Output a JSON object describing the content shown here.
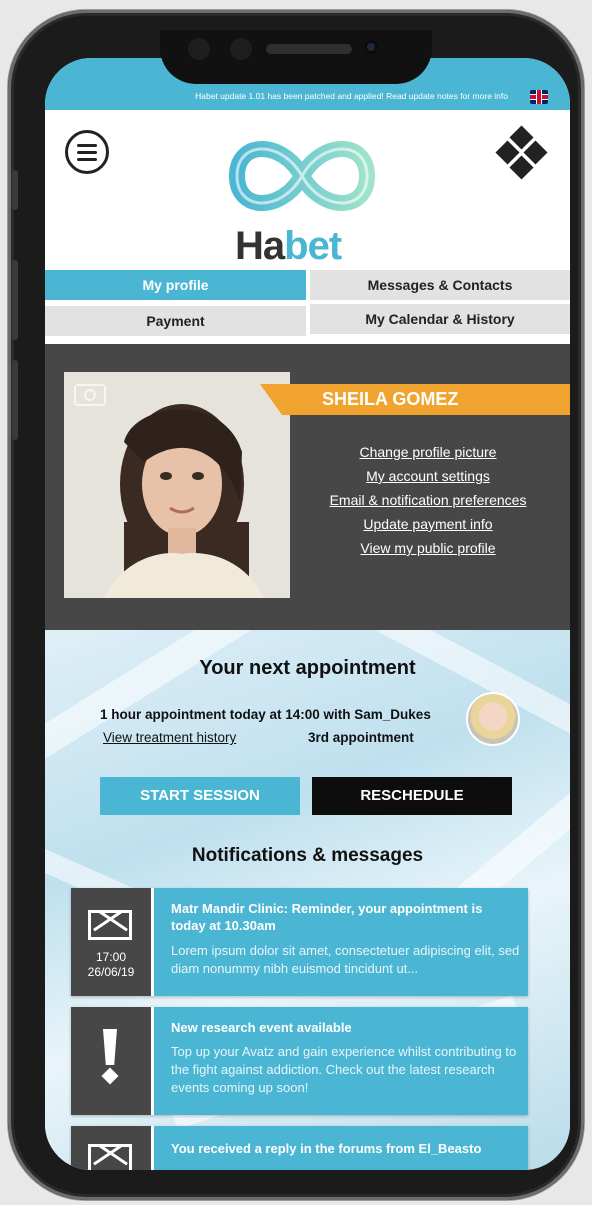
{
  "status_bar": {
    "update_text": "Habet update 1.01 has been patched and applied! Read update notes for more info",
    "flag_icon": "uk-flag-icon"
  },
  "header": {
    "menu_icon": "hamburger-menu-icon",
    "logo_word_a": "Ha",
    "logo_word_b": "bet",
    "apps_icon": "diamond-grid-icon"
  },
  "tabs": [
    {
      "label": "My profile",
      "active": true
    },
    {
      "label": "Messages & Contacts",
      "active": false
    },
    {
      "label": "Payment",
      "active": false
    },
    {
      "label": "My Calendar & History",
      "active": false
    }
  ],
  "profile": {
    "name": "SHEILA GOMEZ",
    "links": [
      "Change profile picture",
      "My account settings",
      "Email & notification preferences",
      "Update payment info",
      "View my public profile"
    ]
  },
  "appointment": {
    "title": "Your next appointment",
    "line": "1 hour appointment today at 14:00 with Sam_Dukes",
    "history_link": "View treatment history",
    "count": "3rd  appointment",
    "start_label": "START SESSION",
    "reschedule_label": "RESCHEDULE"
  },
  "notifications": {
    "title": "Notifications & messages",
    "items": [
      {
        "icon": "envelope-icon",
        "time": "17:00",
        "date": "26/06/19",
        "title": "Matr Mandir Clinic: Reminder, your appointment is today at 10.30am",
        "body": "Lorem ipsum dolor sit amet, consectetuer adipiscing elit, sed diam nonummy nibh euismod tincidunt ut..."
      },
      {
        "icon": "exclamation-icon",
        "title": "New research event available",
        "body": "Top up your Avatz and gain experience whilst contributing to the fight against addiction. Check out the latest research events coming up soon!"
      },
      {
        "icon": "envelope-icon",
        "title": "You received a reply in the forums from El_Beasto",
        "body": ""
      }
    ]
  },
  "colors": {
    "accent": "#4bb6d3",
    "banner": "#f0a32e",
    "dark": "#474747"
  }
}
